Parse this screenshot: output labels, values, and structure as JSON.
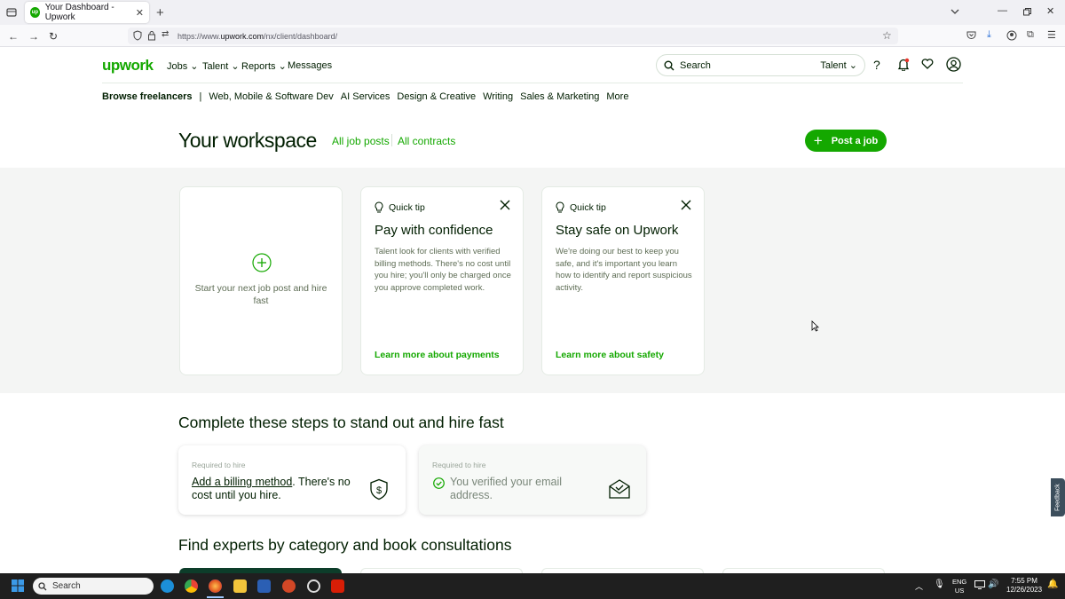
{
  "browser": {
    "tab_title": "Your Dashboard - Upwork",
    "url_prefix": "https://www.",
    "url_domain": "upwork.com",
    "url_path": "/nx/client/dashboard/"
  },
  "header": {
    "logo": "upwork",
    "nav": [
      "Jobs",
      "Talent",
      "Reports",
      "Messages"
    ],
    "search_placeholder": "Search",
    "search_scope": "Talent"
  },
  "categories": {
    "browse_label": "Browse freelancers",
    "separator": "|",
    "items": [
      "Web, Mobile & Software Dev",
      "AI Services",
      "Design & Creative",
      "Writing",
      "Sales & Marketing",
      "More"
    ]
  },
  "workspace": {
    "title": "Your workspace",
    "link_all_posts": "All job posts",
    "link_all_contracts": "All contracts",
    "post_job_label": "Post a job"
  },
  "cards": {
    "new_post_text": "Start your next job post and hire fast",
    "tips": [
      {
        "head": "Quick tip",
        "title": "Pay with confidence",
        "body": "Talent look for clients with verified billing methods. There's no cost until you hire; you'll only be charged once you approve completed work.",
        "link": "Learn more about payments"
      },
      {
        "head": "Quick tip",
        "title": "Stay safe on Upwork",
        "body": "We're doing our best to keep you safe, and it's important you learn how to identify and report suspicious activity.",
        "link": "Learn more about safety"
      }
    ]
  },
  "steps": {
    "title": "Complete these steps to stand out and hire fast",
    "items": [
      {
        "req": "Required to hire",
        "link": "Add a billing method",
        "text": ". There's no cost until you hire."
      },
      {
        "req": "Required to hire",
        "text": "You verified your email address."
      }
    ]
  },
  "find_experts_title": "Find experts by category and book consultations",
  "feedback_label": "Feedback",
  "taskbar": {
    "search": "Search",
    "lang1": "ENG",
    "lang2": "US",
    "time": "7:55 PM",
    "date": "12/26/2023"
  },
  "colors": {
    "brand": "#14a800",
    "text": "#001e00",
    "band": "#f4f5f4"
  }
}
